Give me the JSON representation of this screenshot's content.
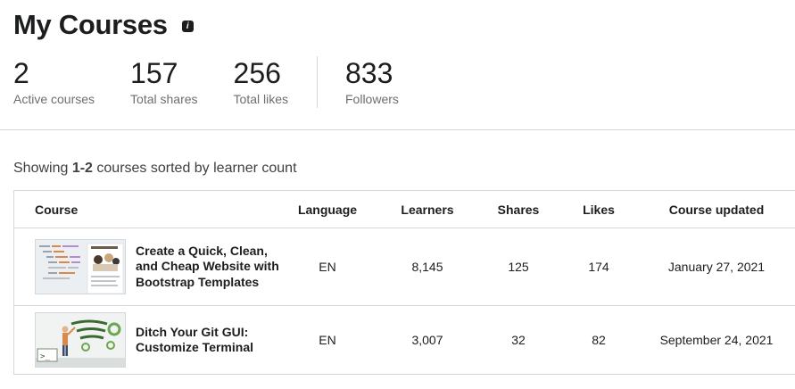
{
  "header": {
    "title": "My Courses",
    "info_icon": "info-icon"
  },
  "stats": [
    {
      "value": "2",
      "label": "Active courses"
    },
    {
      "value": "157",
      "label": "Total shares"
    },
    {
      "value": "256",
      "label": "Total likes"
    },
    {
      "value": "833",
      "label": "Followers"
    }
  ],
  "summary": {
    "prefix": "Showing ",
    "range": "1-2",
    "suffix": " courses sorted by learner count"
  },
  "table": {
    "headers": [
      "Course",
      "Language",
      "Learners",
      "Shares",
      "Likes",
      "Course updated"
    ],
    "rows": [
      {
        "title": "Create a Quick, Clean, and Cheap Website with Bootstrap Templates",
        "language": "EN",
        "learners": "8,145",
        "shares": "125",
        "likes": "174",
        "updated": "January 27, 2021"
      },
      {
        "title": "Ditch Your Git GUI: Customize Terminal",
        "language": "EN",
        "learners": "3,007",
        "shares": "32",
        "likes": "82",
        "updated": "September 24, 2021"
      }
    ]
  },
  "colors": {
    "text": "#1c1d1f",
    "muted": "#6a6f73",
    "border": "#d1d7dc",
    "thumb_green": "#3a6b2e"
  }
}
